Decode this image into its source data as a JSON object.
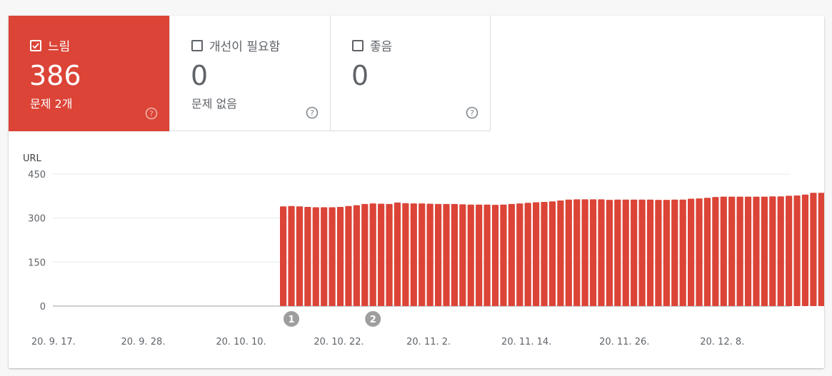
{
  "tiles": [
    {
      "label": "느림",
      "value": "386",
      "sub": "문제 2개",
      "selected": true
    },
    {
      "label": "개선이 필요함",
      "value": "0",
      "sub": "문제 없음",
      "selected": false
    },
    {
      "label": "좋음",
      "value": "0",
      "sub": "",
      "selected": false
    }
  ],
  "colors": {
    "bar": "#db4437",
    "selected_tile": "#db4437",
    "marker": "#9e9e9e"
  },
  "chart_data": {
    "type": "bar",
    "ylabel": "URL",
    "ylim": [
      0,
      450
    ],
    "yticks": [
      0,
      150,
      300,
      450
    ],
    "x_tick_labels": [
      "20. 9. 17.",
      "20. 9. 28.",
      "20. 10. 10.",
      "20. 10. 22.",
      "20. 11. 2.",
      "20. 11. 14.",
      "20. 11. 26.",
      "20. 12. 8."
    ],
    "x_tick_index": [
      0,
      11,
      23,
      35,
      46,
      58,
      70,
      82
    ],
    "num_days": 92,
    "first_bar_index": 28,
    "values": [
      340,
      341,
      340,
      338,
      337,
      337,
      337,
      338,
      341,
      344,
      348,
      350,
      349,
      348,
      353,
      351,
      350,
      350,
      349,
      348,
      348,
      348,
      347,
      346,
      346,
      346,
      345,
      346,
      348,
      350,
      352,
      354,
      355,
      357,
      360,
      363,
      364,
      364,
      364,
      364,
      362,
      363,
      363,
      363,
      363,
      363,
      362,
      362,
      363,
      363,
      366,
      367,
      369,
      372,
      373,
      373,
      373,
      373,
      373,
      373,
      374,
      374,
      376,
      377,
      380,
      386,
      386,
      386
    ],
    "annotations": [
      {
        "label": "1",
        "index": 29
      },
      {
        "label": "2",
        "index": 39
      }
    ],
    "grid": true
  }
}
